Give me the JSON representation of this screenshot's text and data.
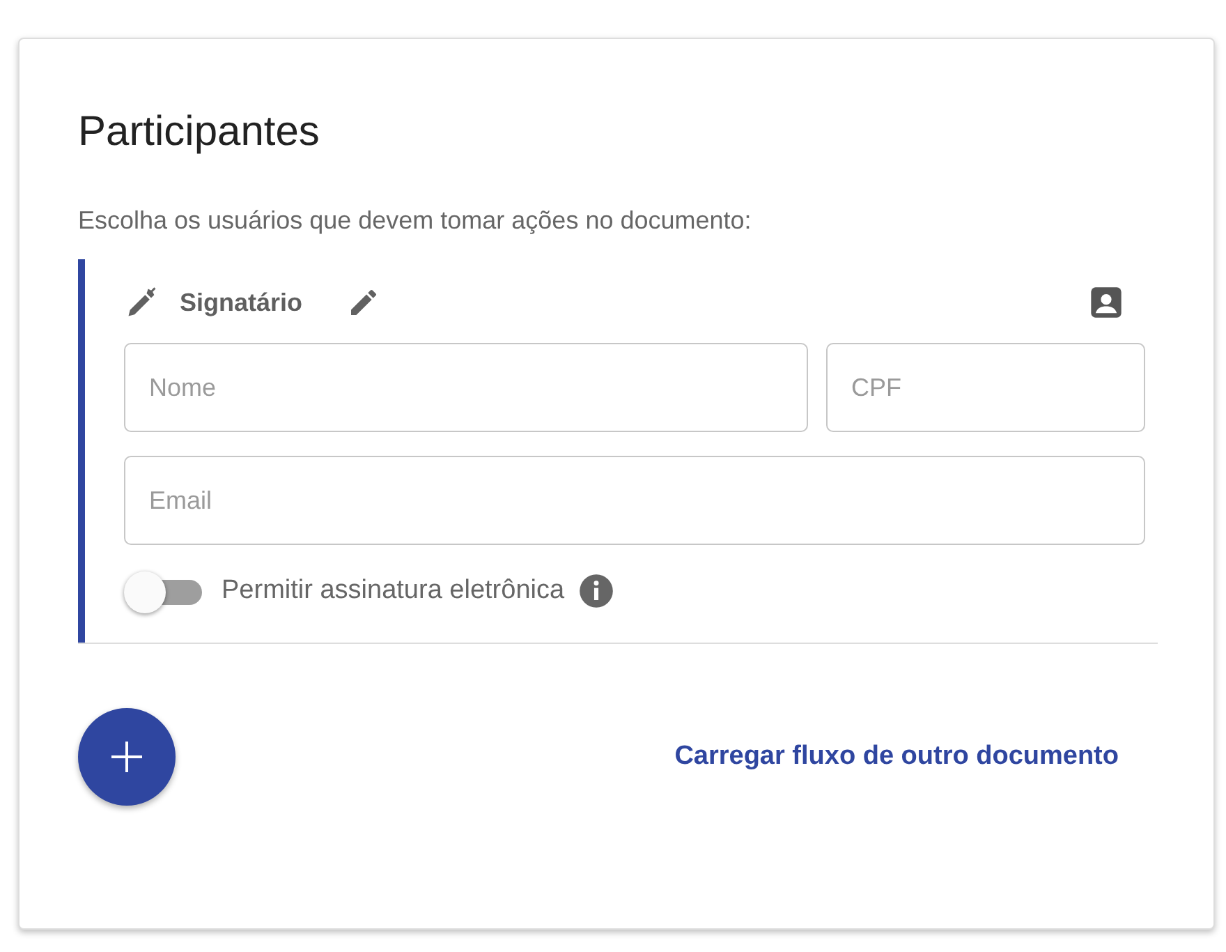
{
  "card": {
    "title": "Participantes",
    "instructions": "Escolha os usuários que devem tomar ações no documento:"
  },
  "participants": [
    {
      "role": "Signatário",
      "fields": [
        {
          "placeholder": "Nome"
        },
        {
          "placeholder": "CPF"
        },
        {
          "placeholder": "Email"
        }
      ],
      "electronic_signature": {
        "label": "Permitir assinatura eletrônica",
        "on": false
      }
    }
  ],
  "actions": {
    "load_link": "Carregar fluxo de outro documento"
  }
}
